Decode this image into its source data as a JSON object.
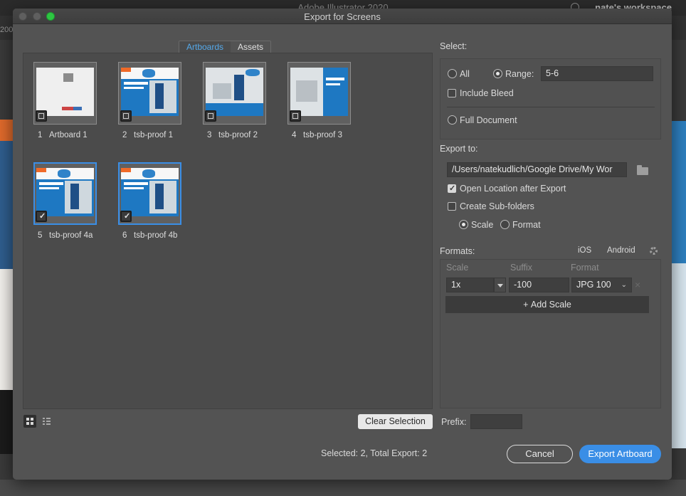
{
  "app": {
    "title": "Adobe Illustrator 2020",
    "workspace": "nate's workspace",
    "zoom": "200"
  },
  "dialog": {
    "title": "Export for Screens",
    "tabs": [
      {
        "label": "Artboards",
        "active": true
      },
      {
        "label": "Assets",
        "active": false
      }
    ],
    "artboards": [
      {
        "num": "1",
        "name": "Artboard 1",
        "selected": false
      },
      {
        "num": "2",
        "name": "tsb-proof 1",
        "selected": false
      },
      {
        "num": "3",
        "name": "tsb-proof 2",
        "selected": false
      },
      {
        "num": "4",
        "name": "tsb-proof 3",
        "selected": false
      },
      {
        "num": "5",
        "name": "tsb-proof 4a",
        "selected": true
      },
      {
        "num": "6",
        "name": "tsb-proof 4b",
        "selected": true
      }
    ],
    "select": {
      "heading": "Select:",
      "all_label": "All",
      "range_label": "Range:",
      "range_value": "5-6",
      "include_bleed_label": "Include Bleed",
      "full_document_label": "Full Document"
    },
    "export_to": {
      "heading": "Export to:",
      "path": "/Users/natekudlich/Google Drive/My Wor",
      "open_location_label": "Open Location after Export",
      "open_location_checked": true,
      "subfolders_label": "Create Sub-folders",
      "subfolders_checked": false,
      "scale_label": "Scale",
      "format_label": "Format"
    },
    "formats": {
      "heading": "Formats:",
      "ios_label": "iOS",
      "android_label": "Android",
      "col_scale": "Scale",
      "col_suffix": "Suffix",
      "col_format": "Format",
      "row": {
        "scale": "1x",
        "suffix": "-100",
        "format": "JPG 100"
      },
      "add_scale_label": "Add Scale"
    },
    "clear_selection_label": "Clear Selection",
    "prefix_label": "Prefix:",
    "prefix_value": "",
    "status": "Selected: 2, Total Export: 2",
    "cancel_label": "Cancel",
    "export_label": "Export Artboard"
  },
  "colors": {
    "accent": "#3a8ee6",
    "dialog_bg": "#535353",
    "panel_bg": "#4b4b4b"
  }
}
